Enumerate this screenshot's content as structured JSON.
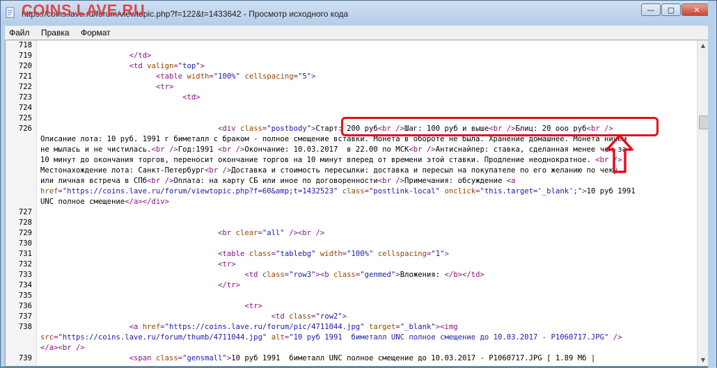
{
  "window": {
    "watermark": "COINS.LAVE.RU",
    "title": "https://coins.lave.ru/forum/viewtopic.php?f=122&t=1433642 - Просмотр исходного кода",
    "buttons": {
      "minimize": "—",
      "maximize": "▢",
      "close": "✕"
    }
  },
  "menu": [
    "Файл",
    "Правка",
    "Формат"
  ],
  "colors": {
    "tag": "#881280",
    "attr": "#994500",
    "value": "#1a1aa6",
    "annotation": "#e0101a"
  },
  "lines": [
    {
      "n": "718",
      "segs": []
    },
    {
      "n": "719",
      "segs": [
        [
          "s",
          "                    "
        ],
        [
          "tag",
          "</td>"
        ]
      ]
    },
    {
      "n": "720",
      "segs": [
        [
          "s",
          "                    "
        ],
        [
          "tag",
          "<td "
        ],
        [
          "attr",
          "valign"
        ],
        [
          "tag",
          "="
        ],
        [
          "val",
          "\"top\""
        ],
        [
          "tag",
          ">"
        ]
      ]
    },
    {
      "n": "721",
      "segs": [
        [
          "s",
          "                          "
        ],
        [
          "tag",
          "<table "
        ],
        [
          "attr",
          "width"
        ],
        [
          "tag",
          "="
        ],
        [
          "val",
          "\"100%\""
        ],
        [
          "tag",
          " "
        ],
        [
          "attr",
          "cellspacing"
        ],
        [
          "tag",
          "="
        ],
        [
          "val",
          "\"5\""
        ],
        [
          "tag",
          ">"
        ]
      ]
    },
    {
      "n": "722",
      "segs": [
        [
          "s",
          "                          "
        ],
        [
          "tag",
          "<tr>"
        ]
      ]
    },
    {
      "n": "723",
      "segs": [
        [
          "s",
          "                                "
        ],
        [
          "tag",
          "<td>"
        ]
      ]
    },
    {
      "n": "724",
      "segs": []
    },
    {
      "n": "725",
      "segs": []
    },
    {
      "n": "726",
      "segs": [
        [
          "s",
          "                                        "
        ],
        [
          "tag",
          "<div "
        ],
        [
          "attr",
          "class"
        ],
        [
          "tag",
          "="
        ],
        [
          "val",
          "\"postbody\""
        ],
        [
          "tag",
          ">"
        ],
        [
          "txt",
          "Старт: 200 руб"
        ],
        [
          "tag",
          "<br />"
        ],
        [
          "txt",
          "Шаг: 100 руб и выше"
        ],
        [
          "tag",
          "<br />"
        ],
        [
          "txt",
          "Блиц: 20 ооо руб"
        ],
        [
          "tag",
          "<br />"
        ]
      ]
    },
    {
      "n": "",
      "segs": [
        [
          "txt",
          "Описание лота: 10 руб. 1991 г биметалл с браком - полное смещение вставки. Монета в обороте не была. Хранение домашнее. Монета ничем"
        ]
      ]
    },
    {
      "n": "",
      "segs": [
        [
          "txt",
          "не мылась и не чистилась."
        ],
        [
          "tag",
          "<br />"
        ],
        [
          "txt",
          "Год:1991 "
        ],
        [
          "tag",
          "<br />"
        ],
        [
          "txt",
          "Окончание: 10.03.2017  в 22.00 по МСК"
        ],
        [
          "tag",
          "<br />"
        ],
        [
          "txt",
          "Антиснайпер: ставка, сделанная менее чем за"
        ]
      ]
    },
    {
      "n": "",
      "segs": [
        [
          "txt",
          "10 минут до окончания торгов, переносит окончание торгов на 10 минут вперед от времени этой ставки. Продление неоднократное. "
        ],
        [
          "tag",
          "<br />"
        ]
      ]
    },
    {
      "n": "",
      "segs": [
        [
          "txt",
          "Местонахождение лота: Санкт-Петербург"
        ],
        [
          "tag",
          "<br />"
        ],
        [
          "txt",
          "Доставка и стоимость пересылки: доставка и пересыл на покупателе по его желанию по чеку"
        ]
      ]
    },
    {
      "n": "",
      "segs": [
        [
          "txt",
          "или личная встреча в СПб"
        ],
        [
          "tag",
          "<br />"
        ],
        [
          "txt",
          "Оплата: на карту СБ или иное по договоренности"
        ],
        [
          "tag",
          "<br />"
        ],
        [
          "txt",
          "Примечания: обсуждение "
        ],
        [
          "tag",
          "<a"
        ]
      ]
    },
    {
      "n": "",
      "segs": [
        [
          "attr",
          "href"
        ],
        [
          "tag",
          "="
        ],
        [
          "val",
          "\"https://coins.lave.ru/forum/viewtopic.php?f=60&amp;t=1432523\""
        ],
        [
          "tag",
          " "
        ],
        [
          "attr",
          "class"
        ],
        [
          "tag",
          "="
        ],
        [
          "val",
          "\"postlink-local\""
        ],
        [
          "tag",
          " "
        ],
        [
          "attr",
          "onclick"
        ],
        [
          "tag",
          "="
        ],
        [
          "val",
          "\"this.target='_blank';\""
        ],
        [
          "tag",
          ">"
        ],
        [
          "txt",
          "10 руб 1991"
        ]
      ]
    },
    {
      "n": "",
      "segs": [
        [
          "txt",
          "UNC полное смещение"
        ],
        [
          "tag",
          "</a></div>"
        ]
      ]
    },
    {
      "n": "727",
      "segs": []
    },
    {
      "n": "728",
      "segs": []
    },
    {
      "n": "729",
      "segs": [
        [
          "s",
          "                                        "
        ],
        [
          "tag",
          "<br "
        ],
        [
          "attr",
          "clear"
        ],
        [
          "tag",
          "="
        ],
        [
          "val",
          "\"all\""
        ],
        [
          "tag",
          " /><br />"
        ]
      ]
    },
    {
      "n": "730",
      "segs": []
    },
    {
      "n": "731",
      "segs": [
        [
          "s",
          "                                        "
        ],
        [
          "tag",
          "<table "
        ],
        [
          "attr",
          "class"
        ],
        [
          "tag",
          "="
        ],
        [
          "val",
          "\"tablebg\""
        ],
        [
          "tag",
          " "
        ],
        [
          "attr",
          "width"
        ],
        [
          "tag",
          "="
        ],
        [
          "val",
          "\"100%\""
        ],
        [
          "tag",
          " "
        ],
        [
          "attr",
          "cellspacing"
        ],
        [
          "tag",
          "="
        ],
        [
          "val",
          "\"1\""
        ],
        [
          "tag",
          ">"
        ]
      ]
    },
    {
      "n": "732",
      "segs": [
        [
          "s",
          "                                        "
        ],
        [
          "tag",
          "<tr>"
        ]
      ]
    },
    {
      "n": "733",
      "segs": [
        [
          "s",
          "                                              "
        ],
        [
          "tag",
          "<td "
        ],
        [
          "attr",
          "class"
        ],
        [
          "tag",
          "="
        ],
        [
          "val",
          "\"row3\""
        ],
        [
          "tag",
          "><b "
        ],
        [
          "attr",
          "class"
        ],
        [
          "tag",
          "="
        ],
        [
          "val",
          "\"genmed\""
        ],
        [
          "tag",
          ">"
        ],
        [
          "txt",
          "Вложения: "
        ],
        [
          "tag",
          "</b></td>"
        ]
      ]
    },
    {
      "n": "734",
      "segs": [
        [
          "s",
          "                                        "
        ],
        [
          "tag",
          "</tr>"
        ]
      ]
    },
    {
      "n": "735",
      "segs": []
    },
    {
      "n": "736",
      "segs": [
        [
          "s",
          "                                              "
        ],
        [
          "tag",
          "<tr>"
        ]
      ]
    },
    {
      "n": "737",
      "segs": [
        [
          "s",
          "                                                    "
        ],
        [
          "tag",
          "<td "
        ],
        [
          "attr",
          "class"
        ],
        [
          "tag",
          "="
        ],
        [
          "val",
          "\"row2\""
        ],
        [
          "tag",
          ">"
        ]
      ]
    },
    {
      "n": "738",
      "segs": [
        [
          "s",
          "                    "
        ],
        [
          "tag",
          "<a "
        ],
        [
          "attr",
          "href"
        ],
        [
          "tag",
          "="
        ],
        [
          "val",
          "\"https://coins.lave.ru/forum/pic/4711044.jpg\""
        ],
        [
          "tag",
          " "
        ],
        [
          "attr",
          "target"
        ],
        [
          "tag",
          "="
        ],
        [
          "val",
          "\"_blank\""
        ],
        [
          "tag",
          "><img"
        ]
      ]
    },
    {
      "n": "",
      "segs": [
        [
          "attr",
          "src"
        ],
        [
          "tag",
          "="
        ],
        [
          "val",
          "\"https://coins.lave.ru/forum/thumb/4711044.jpg\""
        ],
        [
          "tag",
          " "
        ],
        [
          "attr",
          "alt"
        ],
        [
          "tag",
          "="
        ],
        [
          "val",
          "\"10 руб 1991  биметалл UNC полное смещение до 10.03.2017 - P1060717.JPG\""
        ],
        [
          "tag",
          " />"
        ]
      ]
    },
    {
      "n": "",
      "segs": [
        [
          "tag",
          "</a><br />"
        ]
      ]
    },
    {
      "n": "739",
      "segs": [
        [
          "s",
          "                    "
        ],
        [
          "tag",
          "<span "
        ],
        [
          "attr",
          "class"
        ],
        [
          "tag",
          "="
        ],
        [
          "val",
          "\"gensmall\""
        ],
        [
          "tag",
          ">"
        ],
        [
          "txt",
          "10 руб 1991  биметалл UNC полное смещение до 10.03.2017 - P1060717.JPG [ 1.89 Мб |"
        ]
      ]
    }
  ]
}
